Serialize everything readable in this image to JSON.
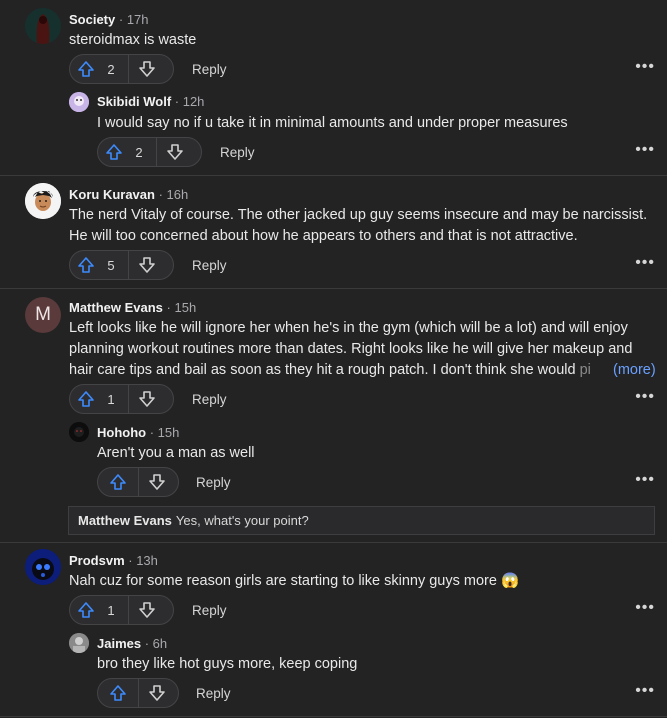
{
  "colors": {
    "accent": "#3d8bfd",
    "background": "#232324"
  },
  "icons": {
    "upvote": "arrow-up-outline-icon",
    "downvote": "arrow-down-outline-icon",
    "more": "more-horizontal-icon"
  },
  "comments": [
    {
      "name": "Society",
      "time": "17h",
      "text": "steroidmax is waste",
      "votes": "2",
      "reply_label": "Reply",
      "replies": [
        {
          "name": "Skibidi Wolf",
          "time": "12h",
          "text": "I would say no if u take it in minimal amounts and under proper measures",
          "votes": "2",
          "reply_label": "Reply"
        }
      ]
    },
    {
      "name": "Koru Kuravan",
      "time": "16h",
      "text": "The nerd Vitaly of course. The other jacked up guy seems insecure and may be narcissist. He will too concerned about how he appears to others and that is not attractive.",
      "votes": "5",
      "reply_label": "Reply",
      "replies": []
    },
    {
      "name": "Matthew Evans",
      "time": "15h",
      "avatar_letter": "M",
      "text": "Left looks like he will ignore her when he's in the gym (which will be a lot) and will enjoy planning workout routines more than dates. Right looks like he will give her makeup and hair care tips and bail as soon as they hit a rough patch. I don't think she would",
      "text_fade": " pi",
      "more_label": "(more)",
      "votes": "1",
      "reply_label": "Reply",
      "replies": [
        {
          "name": "Hohoho",
          "time": "15h",
          "text": "Aren't you a man as well",
          "votes": "",
          "reply_label": "Reply"
        }
      ],
      "quote": {
        "name": "Matthew Evans",
        "text": "Yes, what's your point?"
      }
    },
    {
      "name": "Prodsvm",
      "time": "13h",
      "text": "Nah cuz for some reason girls are starting to like skinny guys more",
      "emoji": "😱",
      "votes": "1",
      "reply_label": "Reply",
      "replies": [
        {
          "name": "Jaimes",
          "time": "6h",
          "text": "bro they like hot guys more, keep coping",
          "votes": "",
          "reply_label": "Reply"
        }
      ]
    }
  ]
}
